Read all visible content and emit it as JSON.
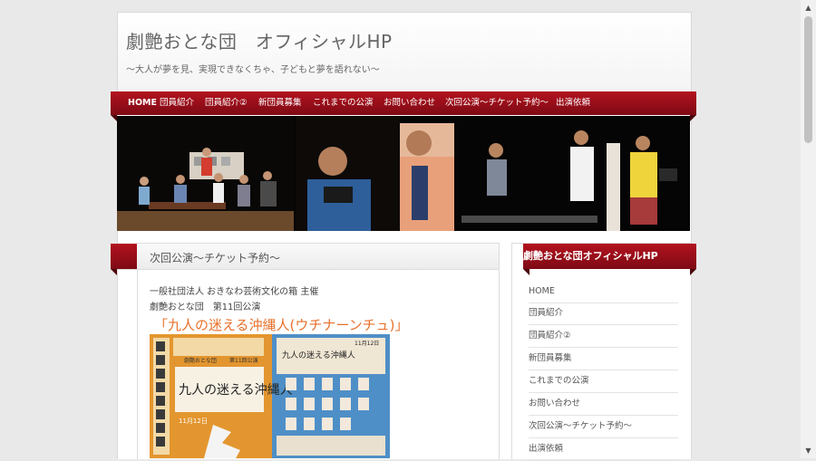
{
  "header": {
    "site_title": "劇艶おとな団　オフィシャルHP",
    "tagline": "〜大人が夢を見、実現できなくちゃ、子どもと夢を語れない〜"
  },
  "nav": {
    "items": [
      {
        "label": "HOME"
      },
      {
        "label": "団員紹介"
      },
      {
        "label": "団員紹介②"
      },
      {
        "label": "新団員募集"
      },
      {
        "label": "これまでの公演"
      },
      {
        "label": "お問い合わせ"
      },
      {
        "label": "次回公演〜チケット予約〜"
      },
      {
        "label": "出演依頼"
      }
    ]
  },
  "content": {
    "page_title": "次回公演〜チケット予約〜",
    "organizer": "一般社団法人 おきなわ芸術文化の箱 主催",
    "performance": "劇艶おとな団　第11回公演",
    "play_title": "「九人の迷える沖縄人(ウチナーンチュ)」"
  },
  "poster": {
    "logo_text": "劇艶おとな団",
    "edition": "第11回公演",
    "title_art": "九人の迷える沖縄人",
    "date_text": "11月12日",
    "title_art_small": "九人の迷える沖縄人",
    "date_small": "11月12日"
  },
  "sidebar": {
    "title": "劇艶おとな団オフィシャルHP",
    "items": [
      {
        "label": "HOME"
      },
      {
        "label": "団員紹介"
      },
      {
        "label": "団員紹介②"
      },
      {
        "label": "新団員募集"
      },
      {
        "label": "これまでの公演"
      },
      {
        "label": "お問い合わせ"
      },
      {
        "label": "次回公演〜チケット予約〜"
      },
      {
        "label": "出演依頼"
      }
    ]
  },
  "colors": {
    "accent": "#a30f1b",
    "title_orange": "#e8702a",
    "poster_orange": "#e9a036",
    "poster_blue": "#4f8fc7"
  },
  "icons": {
    "scroll_up": "scroll-up-arrow-icon",
    "scroll_down": "scroll-down-arrow-icon"
  }
}
